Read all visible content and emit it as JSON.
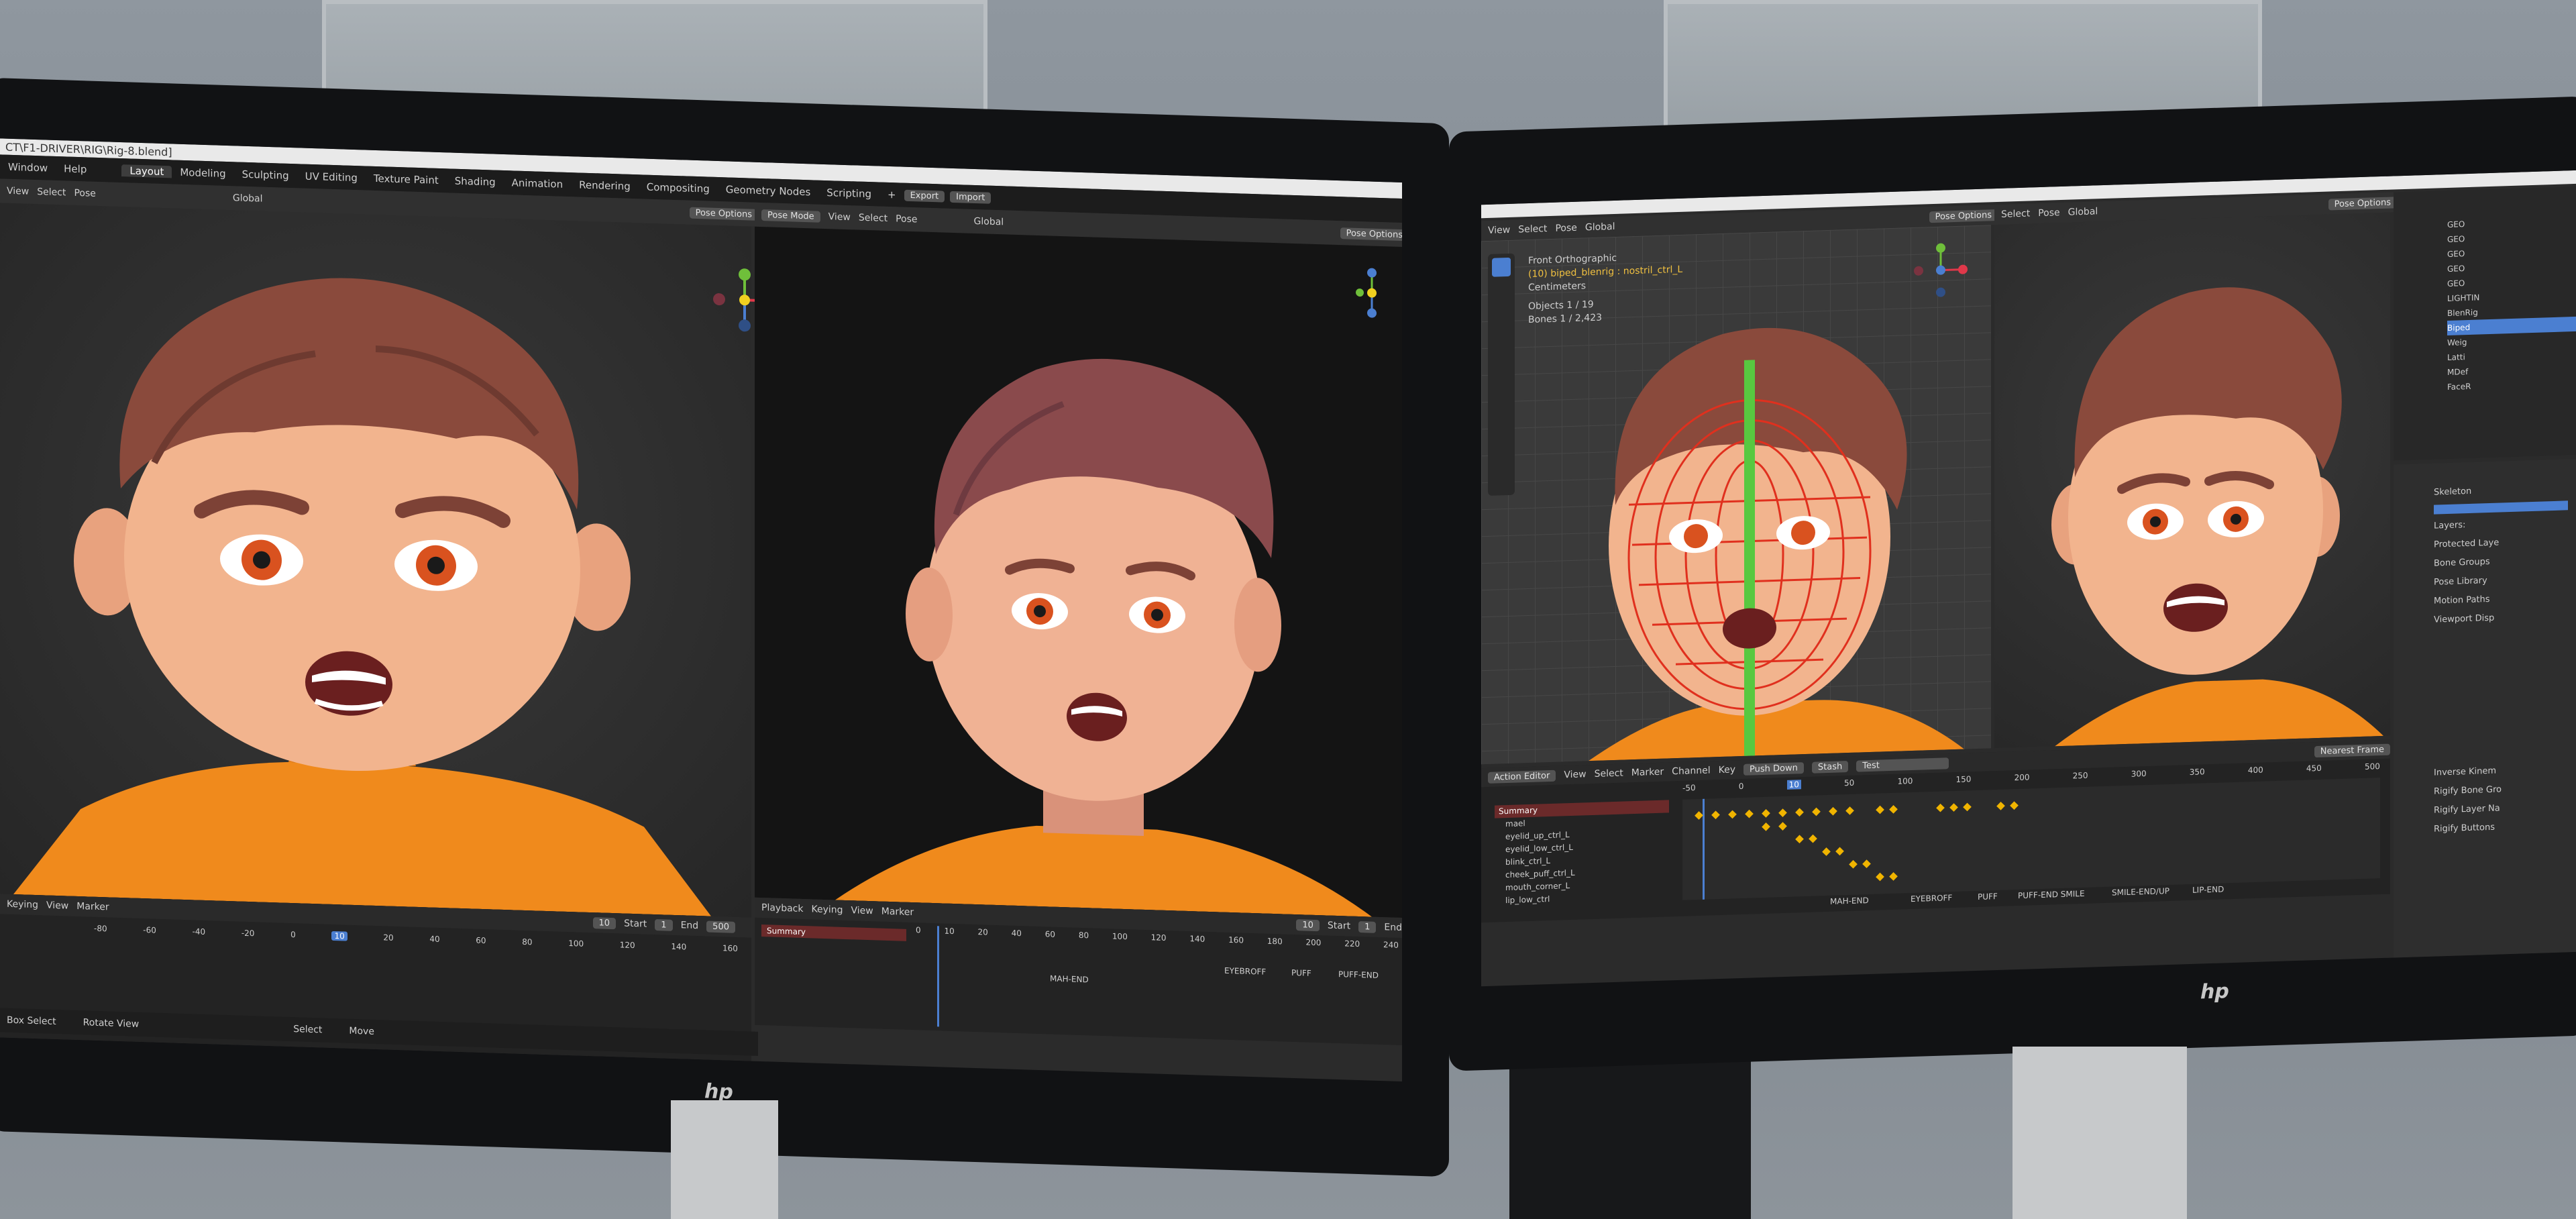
{
  "left_monitor": {
    "title": "CT\\F1-DRIVER\\RIG\\Rig-8.blend]",
    "menus": [
      "Window",
      "Help"
    ],
    "workspaces": [
      "Layout",
      "Modeling",
      "Sculpting",
      "UV Editing",
      "Texture Paint",
      "Shading",
      "Animation",
      "Rendering",
      "Compositing",
      "Geometry Nodes",
      "Scripting"
    ],
    "export_label": "Export",
    "import_label": "Import",
    "left_header": [
      "View",
      "Select",
      "Pose"
    ],
    "global_label": "Global",
    "pose_options": "Pose Options",
    "pose_mode": "Pose Mode",
    "right_header": [
      "View",
      "Select",
      "Pose"
    ],
    "timeline": {
      "keying": "Keying",
      "view": "View",
      "marker": "Marker",
      "frame": "10",
      "start_label": "Start",
      "start": "1",
      "end_label": "End",
      "end": "500",
      "ticks": [
        "-80",
        "-60",
        "-40",
        "-20",
        "0",
        "10",
        "20",
        "40",
        "60",
        "80",
        "100",
        "120",
        "140",
        "160"
      ]
    },
    "right_timeline": {
      "playback": "Playback",
      "keying": "Keying",
      "view": "View",
      "marker": "Marker",
      "frame": "10",
      "start_label": "Start",
      "start": "1",
      "end_label": "End",
      "ticks": [
        "0",
        "10",
        "20",
        "40",
        "60",
        "80",
        "100",
        "120",
        "140",
        "160",
        "180",
        "200",
        "220",
        "240"
      ],
      "summary": "Summary",
      "markers": [
        "MAH-END",
        "EYEBROFF",
        "PUFF",
        "PUFF-END"
      ]
    },
    "status": {
      "box_select": "Box Select",
      "rotate_view": "Rotate View",
      "select": "Select",
      "move": "Move"
    },
    "brand": "hp"
  },
  "right_monitor": {
    "header": [
      "View",
      "Select",
      "Pose"
    ],
    "global_label": "Global",
    "pose_options": "Pose Options",
    "viewport_info": {
      "view": "Front Orthographic",
      "object": "(10) biped_blenrig : nostril_ctrl_L",
      "units": "Centimeters",
      "objects_label": "Objects",
      "objects": "1 / 19",
      "bones_label": "Bones",
      "bones": "1 / 2,423"
    },
    "action_editor": {
      "mode": "Action Editor",
      "menus": [
        "View",
        "Select",
        "Marker",
        "Channel",
        "Key"
      ],
      "push_down": "Push Down",
      "stash": "Stash",
      "action": "Test",
      "snap": "Nearest Frame",
      "ticks": [
        "-50",
        "0",
        "10",
        "50",
        "100",
        "150",
        "200",
        "250",
        "300",
        "350",
        "400",
        "450",
        "500"
      ],
      "summary": "Summary",
      "channels": [
        "mael",
        "eyelid_up_ctrl_L",
        "eyelid_low_ctrl_L",
        "blink_ctrl_L",
        "cheek_puff_ctrl_L",
        "mouth_corner_L",
        "lip_low_ctrl"
      ],
      "markers": [
        "MAH-END",
        "EYEBROFF",
        "PUFF",
        "PUFF-END SMILE",
        "SMILE-END/UP",
        "LIP-END"
      ]
    },
    "properties": {
      "skeleton": "Skeleton",
      "layers": "Layers:",
      "protected": "Protected Laye",
      "sections": [
        "Bone Groups",
        "Pose Library",
        "Motion Paths",
        "Viewport Disp"
      ],
      "bottom_sections": [
        "Inverse Kinem",
        "Rigify Bone Gro",
        "Rigify Layer Na",
        "Rigify Buttons"
      ]
    },
    "outliner": [
      "GEO",
      "GEO",
      "GEO",
      "GEO",
      "GEO",
      "LIGHTIN",
      "BlenRig",
      "Biped",
      "Weig",
      "Latti",
      "MDef",
      "FaceR"
    ],
    "brand": "hp"
  },
  "colors": {
    "blender_bg": "#2b2b2b",
    "header": "#303030",
    "accent_blue": "#4b7fd1",
    "keyframe": "#f0b400",
    "shirt": "#f08a1c",
    "hair": "#8a4a3c",
    "skin": "#f2b48e"
  }
}
